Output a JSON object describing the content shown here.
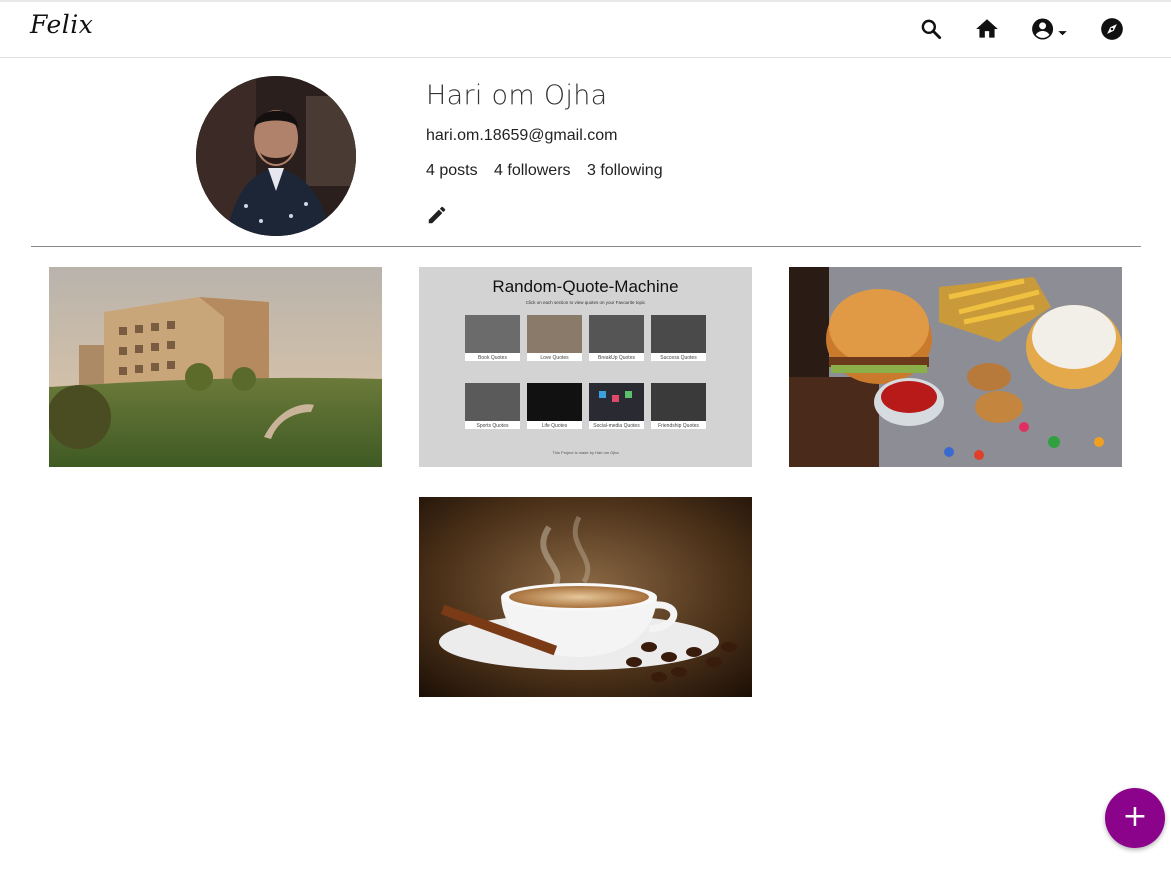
{
  "navbar": {
    "brand": "Felix",
    "icons": [
      "search-icon",
      "home-icon",
      "account-icon",
      "explore-icon"
    ]
  },
  "profile": {
    "name": "Hari om Ojha",
    "email": "hari.om.18659@gmail.com",
    "posts": "4 posts",
    "followers": "4 followers",
    "following": "3 following"
  },
  "posts": {
    "quote_machine": {
      "title": "Random-Quote-Machine",
      "subtitle": "Click on each section to view quotes on your Favourite topic",
      "tiles": [
        "Book Quotes",
        "Love Quotes",
        "BreakUp Quotes",
        "Success Quotes",
        "Sports Quotes",
        "Life Quotes",
        "Social-media Quotes",
        "Friendship Quotes"
      ],
      "footer": "This Project is made by Hari om Ojha"
    }
  },
  "fab": {
    "label": "+"
  },
  "colors": {
    "accent": "#8b028b",
    "divider": "#8a8a8a"
  }
}
